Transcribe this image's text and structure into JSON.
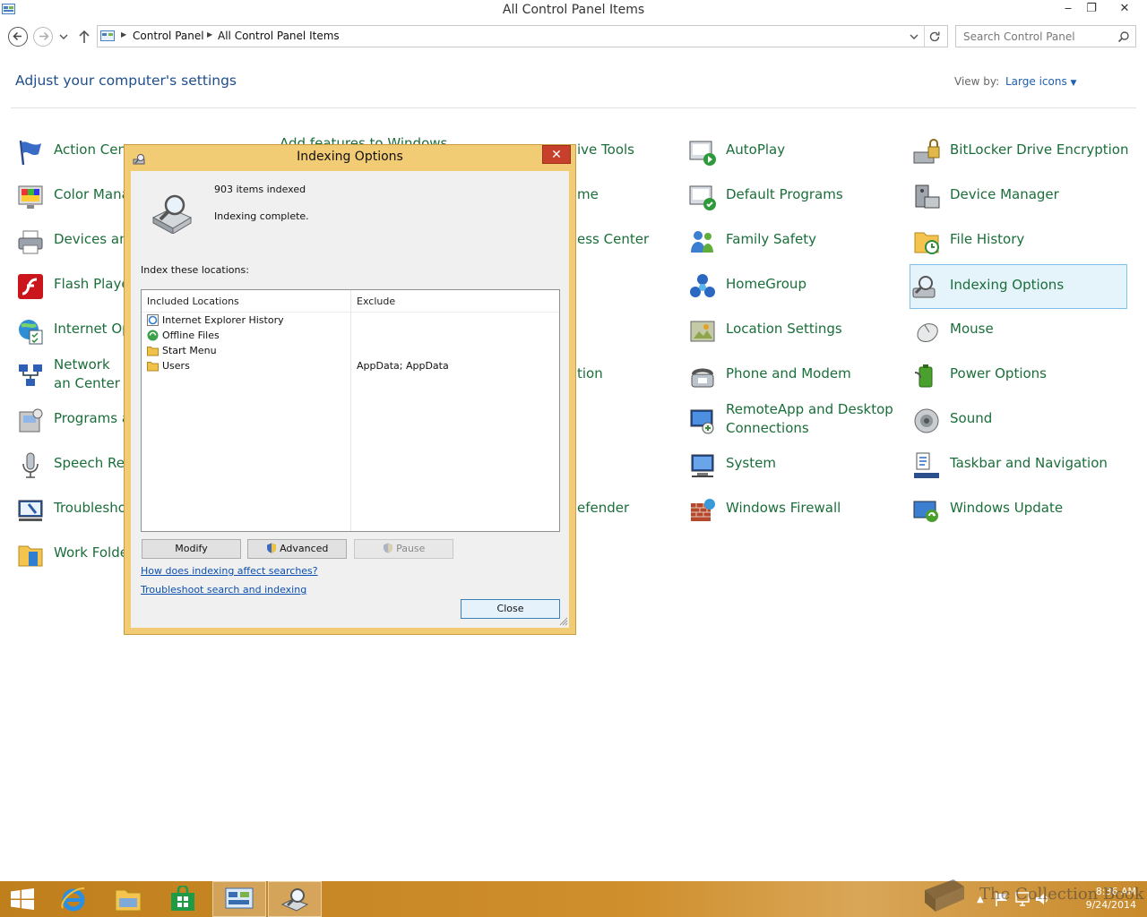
{
  "window": {
    "title": "All Control Panel Items",
    "minimize": "‒",
    "maximize": "❐",
    "close": "✕"
  },
  "address": {
    "crumbs": [
      "Control Panel",
      "All Control Panel Items"
    ],
    "search_placeholder": "Search Control Panel"
  },
  "header": {
    "title": "Adjust your computer's settings",
    "view_by_label": "View by:",
    "view_by_value": "Large icons"
  },
  "items": {
    "c1": [
      "Action Cent",
      "Color Mana",
      "Devices and",
      "Flash Playe",
      "Internet Op",
      "Network an Center",
      "Programs a",
      "Speech Rec",
      "Troublesho",
      "Work Folde"
    ],
    "c2_top": "Add features to Windows",
    "c3": [
      "ive Tools",
      "me",
      "ess Center",
      "tion",
      "efender"
    ],
    "c4": [
      "AutoPlay",
      "Default Programs",
      "Family Safety",
      "HomeGroup",
      "Location Settings",
      "Phone and Modem",
      "RemoteApp and Desktop Connections",
      "System",
      "Windows Firewall"
    ],
    "c5": [
      "BitLocker Drive Encryption",
      "Device Manager",
      "File History",
      "Indexing Options",
      "Mouse",
      "Power Options",
      "Sound",
      "Taskbar and Navigation",
      "Windows Update"
    ]
  },
  "dialog": {
    "title": "Indexing Options",
    "items_indexed": "903 items indexed",
    "status": "Indexing complete.",
    "index_label": "Index these locations:",
    "columns": [
      "Included Locations",
      "Exclude"
    ],
    "rows": [
      {
        "name": "Internet Explorer History",
        "exclude": ""
      },
      {
        "name": "Offline Files",
        "exclude": ""
      },
      {
        "name": "Start Menu",
        "exclude": ""
      },
      {
        "name": "Users",
        "exclude": "AppData; AppData"
      }
    ],
    "buttons": {
      "modify": "Modify",
      "advanced": "Advanced",
      "pause": "Pause",
      "close": "Close"
    },
    "links": {
      "how": "How does indexing affect searches?",
      "troubleshoot": "Troubleshoot search and indexing"
    }
  },
  "taskbar": {
    "time": "8:36 AM",
    "date": "9/24/2014",
    "watermark": "The Collection Book"
  },
  "colors": {
    "item_text": "#1a6e3a",
    "link": "#1e4e8c",
    "dialog_frame": "#f2cc74",
    "taskbar": "#c88a2b",
    "selection": "#e5f3fb"
  }
}
